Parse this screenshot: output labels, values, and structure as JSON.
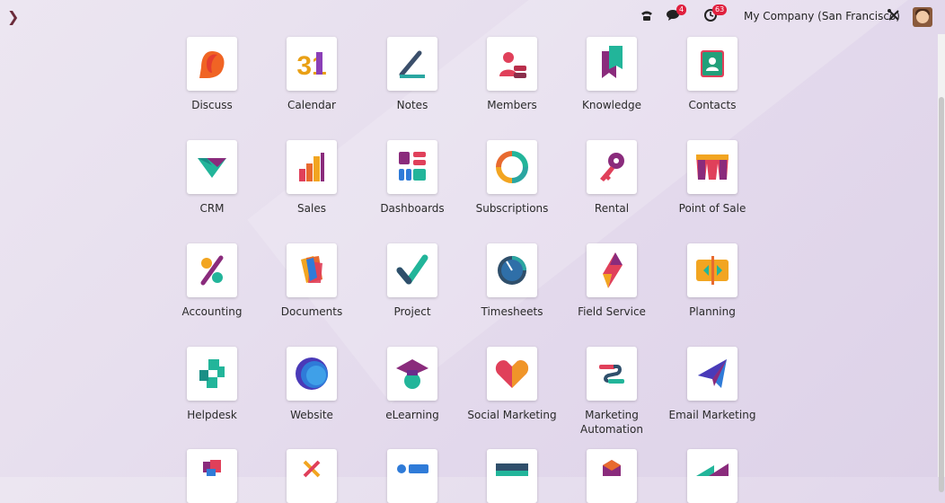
{
  "topbar": {
    "company": "My Company (San Francisco)",
    "messages_badge": "4",
    "activities_badge": "63",
    "icons": [
      "phone-icon",
      "chat-icon",
      "clock-icon",
      "tools-icon",
      "avatar"
    ]
  },
  "apps": [
    {
      "label": "Discuss"
    },
    {
      "label": "Calendar"
    },
    {
      "label": "Notes"
    },
    {
      "label": "Members"
    },
    {
      "label": "Knowledge"
    },
    {
      "label": "Contacts"
    },
    {
      "label": "CRM"
    },
    {
      "label": "Sales"
    },
    {
      "label": "Dashboards"
    },
    {
      "label": "Subscriptions"
    },
    {
      "label": "Rental"
    },
    {
      "label": "Point of Sale"
    },
    {
      "label": "Accounting"
    },
    {
      "label": "Documents"
    },
    {
      "label": "Project"
    },
    {
      "label": "Timesheets"
    },
    {
      "label": "Field Service"
    },
    {
      "label": "Planning"
    },
    {
      "label": "Helpdesk"
    },
    {
      "label": "Website"
    },
    {
      "label": "eLearning"
    },
    {
      "label": "Social Marketing"
    },
    {
      "label": "Marketing Automation"
    },
    {
      "label": "Email Marketing"
    }
  ],
  "calendar_icon_text": "31",
  "colors": {
    "accent": "#714b67",
    "badge": "#e01f3d"
  }
}
